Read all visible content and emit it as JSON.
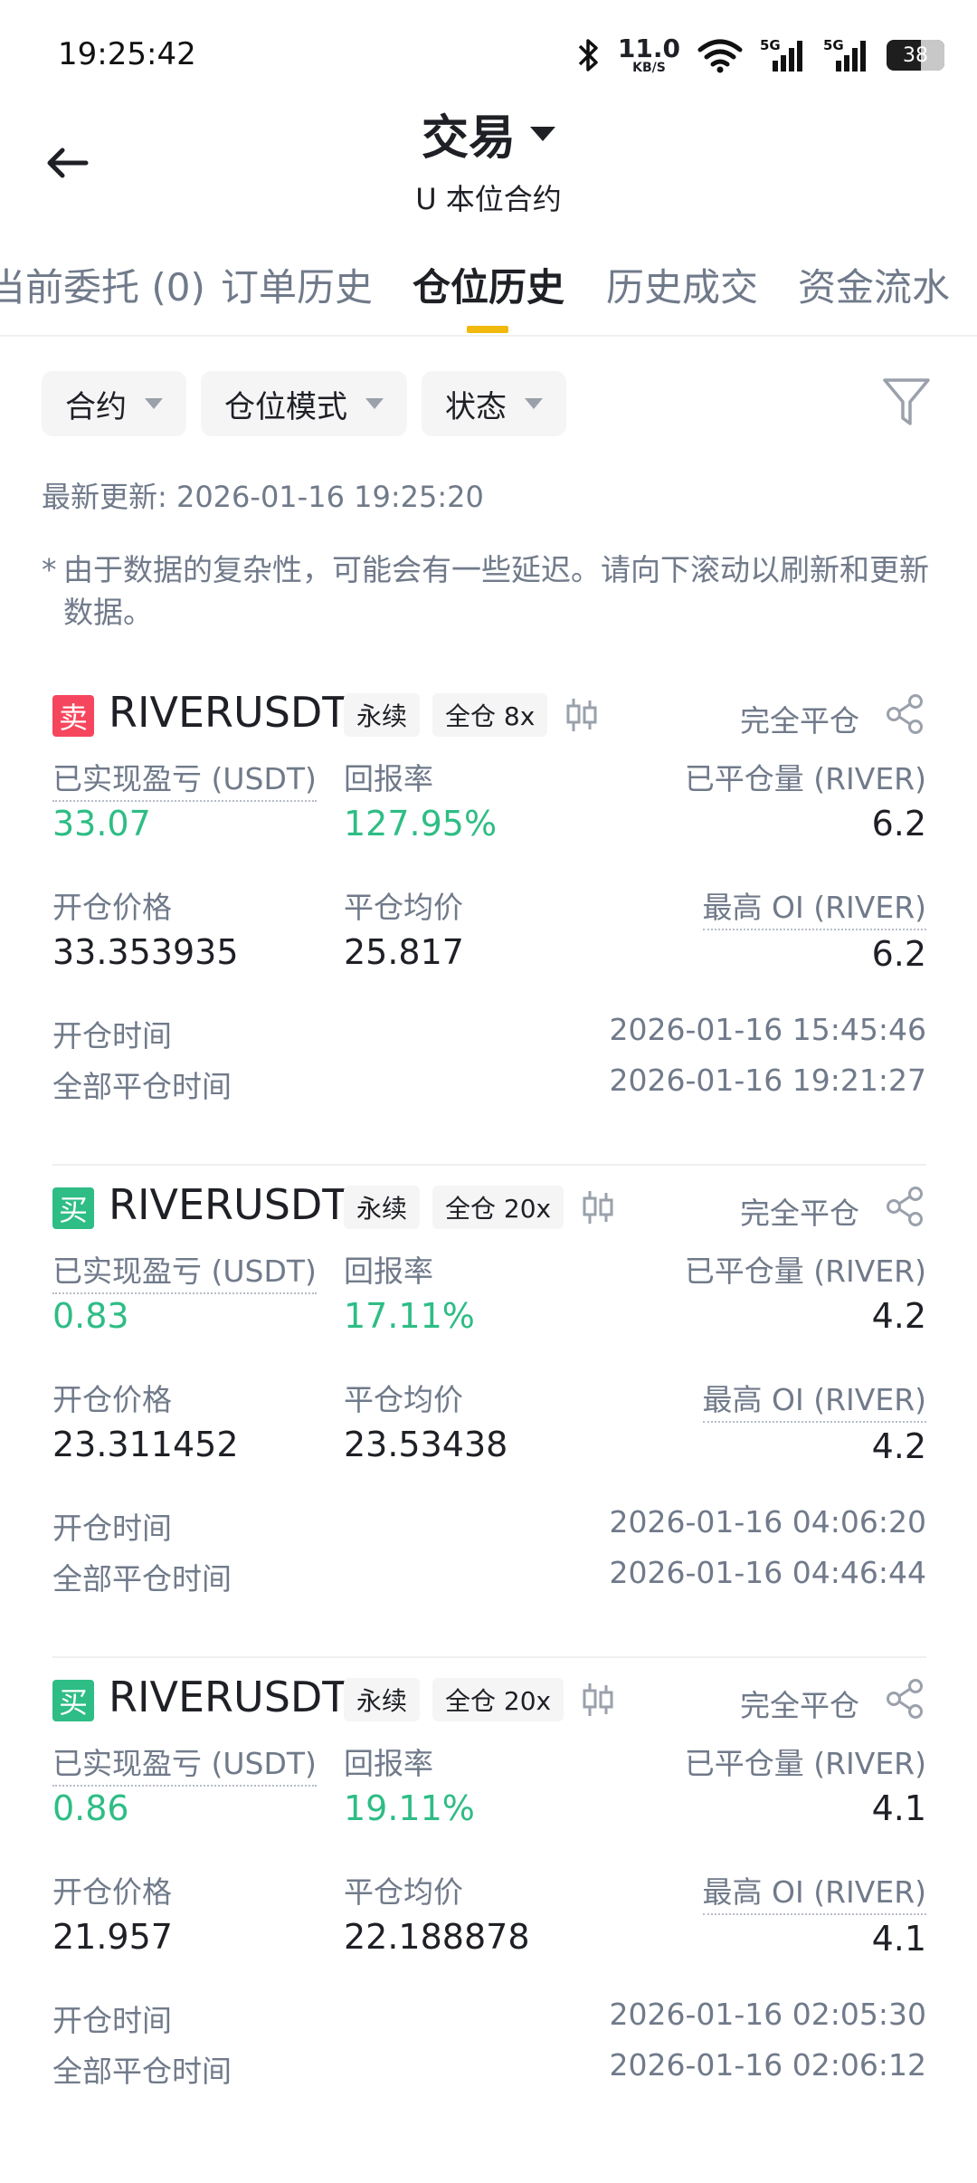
{
  "status_bar": {
    "time": "19:25:42",
    "net_speed_value": "11.0",
    "net_speed_unit": "KB/S",
    "battery": "38",
    "sim1": "5G",
    "sim2": "5G"
  },
  "header": {
    "title": "交易",
    "subtitle": "U 本位合约"
  },
  "tabs": [
    {
      "label": "当前委托 (0)",
      "active": false
    },
    {
      "label": "订单历史",
      "active": false
    },
    {
      "label": "仓位历史",
      "active": true
    },
    {
      "label": "历史成交",
      "active": false
    },
    {
      "label": "资金流水",
      "active": false
    }
  ],
  "filters": {
    "contract": "合约",
    "position_mode": "仓位模式",
    "status": "状态"
  },
  "updated": "最新更新: 2026-01-16 19:25:20",
  "notice": {
    "star": "*",
    "text": "由于数据的复杂性，可能会有一些延迟。请向下滚动以刷新和更新数据。"
  },
  "labels": {
    "pnl": "已实现盈亏 (USDT)",
    "roi": "回报率",
    "closed_qty": "已平仓量 (RIVER)",
    "entry_price": "开仓价格",
    "avg_close_price": "平仓均价",
    "max_oi": "最高 OI (RIVER)",
    "open_time": "开仓时间",
    "close_time": "全部平仓时间"
  },
  "positions": [
    {
      "side": "卖",
      "side_color": "#f6465d",
      "symbol": "RIVERUSDT",
      "type": "永续",
      "margin": "全仓 8x",
      "status": "完全平仓",
      "pnl": "33.07",
      "roi": "127.95%",
      "closed_qty": "6.2",
      "entry_price": "33.353935",
      "avg_close_price": "25.817",
      "max_oi": "6.2",
      "open_time": "2026-01-16 15:45:46",
      "close_time": "2026-01-16 19:21:27"
    },
    {
      "side": "买",
      "side_color": "#2ebd85",
      "symbol": "RIVERUSDT",
      "type": "永续",
      "margin": "全仓 20x",
      "status": "完全平仓",
      "pnl": "0.83",
      "roi": "17.11%",
      "closed_qty": "4.2",
      "entry_price": "23.311452",
      "avg_close_price": "23.53438",
      "max_oi": "4.2",
      "open_time": "2026-01-16 04:06:20",
      "close_time": "2026-01-16 04:46:44"
    },
    {
      "side": "买",
      "side_color": "#2ebd85",
      "symbol": "RIVERUSDT",
      "type": "永续",
      "margin": "全仓 20x",
      "status": "完全平仓",
      "pnl": "0.86",
      "roi": "19.11%",
      "closed_qty": "4.1",
      "entry_price": "21.957",
      "avg_close_price": "22.188878",
      "max_oi": "4.1",
      "open_time": "2026-01-16 02:05:30",
      "close_time": "2026-01-16 02:06:12"
    }
  ],
  "colors": {
    "accent": "#f0b90b",
    "profit": "#2ebd85",
    "loss": "#f6465d",
    "muted": "#707a8a"
  }
}
